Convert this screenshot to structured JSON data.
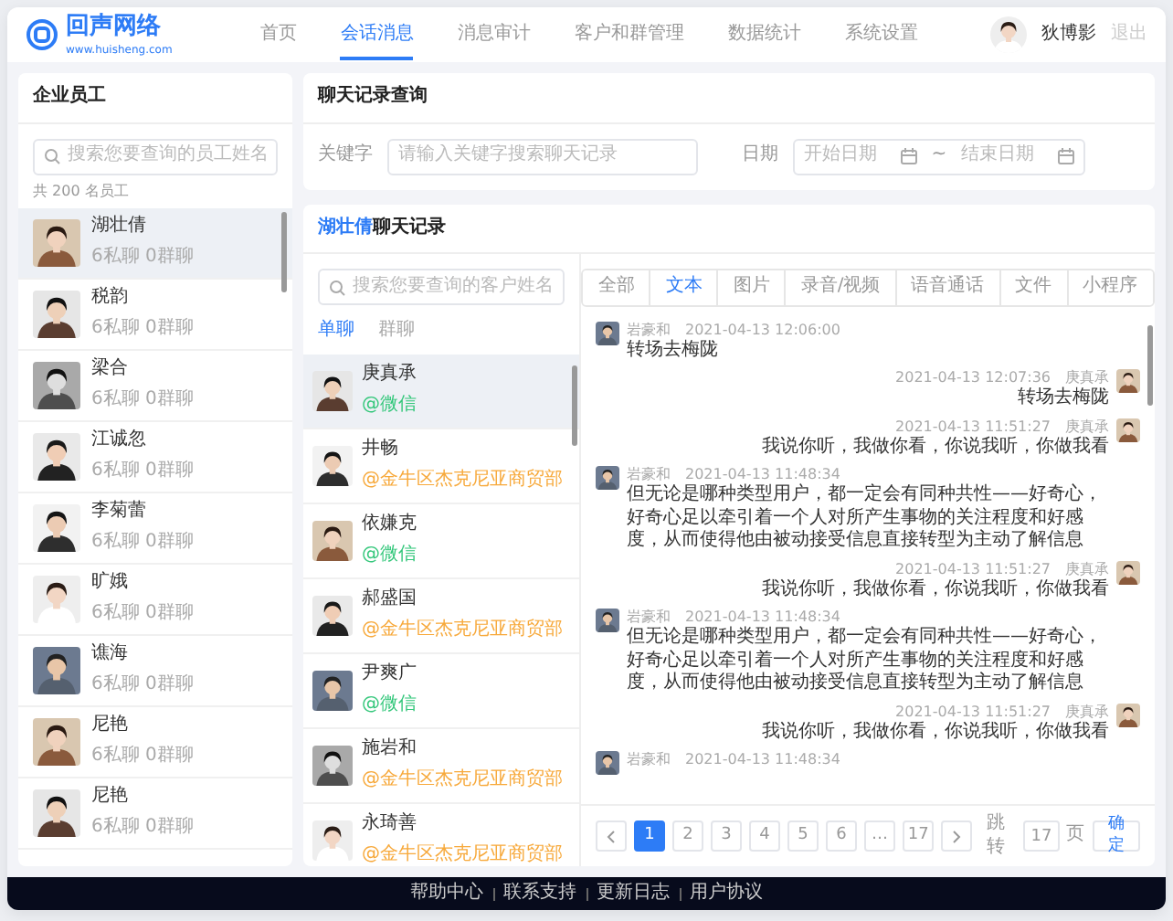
{
  "header": {
    "logo": {
      "name": "回声网络",
      "url": "www.huisheng.com"
    },
    "nav": [
      {
        "label": "首页",
        "selected": false
      },
      {
        "label": "会话消息",
        "selected": true
      },
      {
        "label": "消息审计",
        "selected": false
      },
      {
        "label": "客户和群管理",
        "selected": false
      },
      {
        "label": "数据统计",
        "selected": false
      },
      {
        "label": "系统设置",
        "selected": false
      }
    ],
    "user": {
      "name": "狄博影",
      "logout": "退出"
    }
  },
  "employees": {
    "title": "企业员工",
    "search_placeholder": "搜索您要查询的员工姓名",
    "count": "共 200 名员工",
    "items": [
      {
        "name": "湖壮倩",
        "stats": "6私聊 0群聊",
        "selected": true
      },
      {
        "name": "税韵",
        "stats": "6私聊 0群聊",
        "selected": false
      },
      {
        "name": "梁合",
        "stats": "6私聊 0群聊",
        "selected": false
      },
      {
        "name": "江诚忽",
        "stats": "6私聊 0群聊",
        "selected": false
      },
      {
        "name": "李菊蕾",
        "stats": "6私聊 0群聊",
        "selected": false
      },
      {
        "name": "旷娥",
        "stats": "6私聊 0群聊",
        "selected": false
      },
      {
        "name": "谯海",
        "stats": "6私聊 0群聊",
        "selected": false
      },
      {
        "name": "尼艳",
        "stats": "6私聊 0群聊",
        "selected": false
      },
      {
        "name": "尼艳",
        "stats": "6私聊 0群聊",
        "selected": false
      }
    ]
  },
  "query": {
    "title": "聊天记录查询",
    "keyword_label": "关键字",
    "keyword_placeholder": "请输入关键字搜索聊天记录",
    "date_label": "日期",
    "start_placeholder": "开始日期",
    "separator": "~",
    "end_placeholder": "结束日期"
  },
  "chat": {
    "title_name": "湖壮倩",
    "title_suffix": "聊天记录",
    "customer_search_placeholder": "搜索您要查询的客户姓名",
    "chat_tabs": [
      {
        "label": "单聊",
        "selected": true
      },
      {
        "label": "群聊",
        "selected": false
      }
    ],
    "customers": [
      {
        "name": "庚真承",
        "tag": "@微信",
        "color": "#34c77b",
        "selected": true
      },
      {
        "name": "井畅",
        "tag": "@金牛区杰克尼亚商贸部",
        "color": "#f7a93b",
        "selected": false
      },
      {
        "name": "依嫌克",
        "tag": "@微信",
        "color": "#34c77b",
        "selected": false
      },
      {
        "name": "郝盛国",
        "tag": "@金牛区杰克尼亚商贸部",
        "color": "#f7a93b",
        "selected": false
      },
      {
        "name": "尹爽广",
        "tag": "@微信",
        "color": "#34c77b",
        "selected": false
      },
      {
        "name": "施岩和",
        "tag": "@金牛区杰克尼亚商贸部",
        "color": "#f7a93b",
        "selected": false
      },
      {
        "name": "永琦善",
        "tag": "@金牛区杰克尼亚商贸部",
        "color": "#f7a93b",
        "selected": false
      }
    ],
    "type_tabs": [
      {
        "label": "全部",
        "selected": false
      },
      {
        "label": "文本",
        "selected": true
      },
      {
        "label": "图片",
        "selected": false
      },
      {
        "label": "录音/视频",
        "selected": false
      },
      {
        "label": "语音通话",
        "selected": false
      },
      {
        "label": "文件",
        "selected": false
      },
      {
        "label": "小程序",
        "selected": false
      }
    ],
    "messages": [
      {
        "kind": "incoming",
        "sender": "岩豪和",
        "time": "2021-04-13 12:06:00",
        "text": "转场去梅陇"
      },
      {
        "kind": "outgoing",
        "sender": "庚真承",
        "time": "2021-04-13 12:07:36",
        "text": "转场去梅陇"
      },
      {
        "kind": "outgoing",
        "sender": "庚真承",
        "time": "2021-04-13 11:51:27",
        "text": "我说你听，我做你看，你说我听，你做我看"
      },
      {
        "kind": "incoming",
        "sender": "岩豪和",
        "time": "2021-04-13 11:48:34",
        "text": "但无论是哪种类型用户，都一定会有同种共性——好奇心，好奇心足以牵引着一个人对所产生事物的关注程度和好感度，从而使得他由被动接受信息直接转型为主动了解信息"
      },
      {
        "kind": "outgoing",
        "sender": "庚真承",
        "time": "2021-04-13 11:51:27",
        "text": "我说你听，我做你看，你说我听，你做我看"
      },
      {
        "kind": "incoming",
        "sender": "岩豪和",
        "time": "2021-04-13 11:48:34",
        "text": "但无论是哪种类型用户，都一定会有同种共性——好奇心，好奇心足以牵引着一个人对所产生事物的关注程度和好感度，从而使得他由被动接受信息直接转型为主动了解信息"
      },
      {
        "kind": "outgoing",
        "sender": "庚真承",
        "time": "2021-04-13 11:51:27",
        "text": "我说你听，我做你看，你说我听，你做我看"
      },
      {
        "kind": "incoming",
        "sender": "岩豪和",
        "time": "2021-04-13 11:48:34"
      }
    ],
    "pagination": {
      "pages": [
        {
          "label": "1",
          "selected": true
        },
        {
          "label": "2",
          "selected": false
        },
        {
          "label": "3",
          "selected": false
        },
        {
          "label": "4",
          "selected": false
        },
        {
          "label": "5",
          "selected": false
        },
        {
          "label": "6",
          "selected": false
        },
        {
          "label": "…",
          "selected": false
        },
        {
          "label": "17",
          "selected": false
        }
      ],
      "jump_label": "跳转",
      "jump_value": "17",
      "page_unit": "页",
      "confirm": "确定"
    }
  },
  "footer": {
    "links": [
      "帮助中心",
      "联系支持",
      "更新日志",
      "用户协议"
    ]
  }
}
